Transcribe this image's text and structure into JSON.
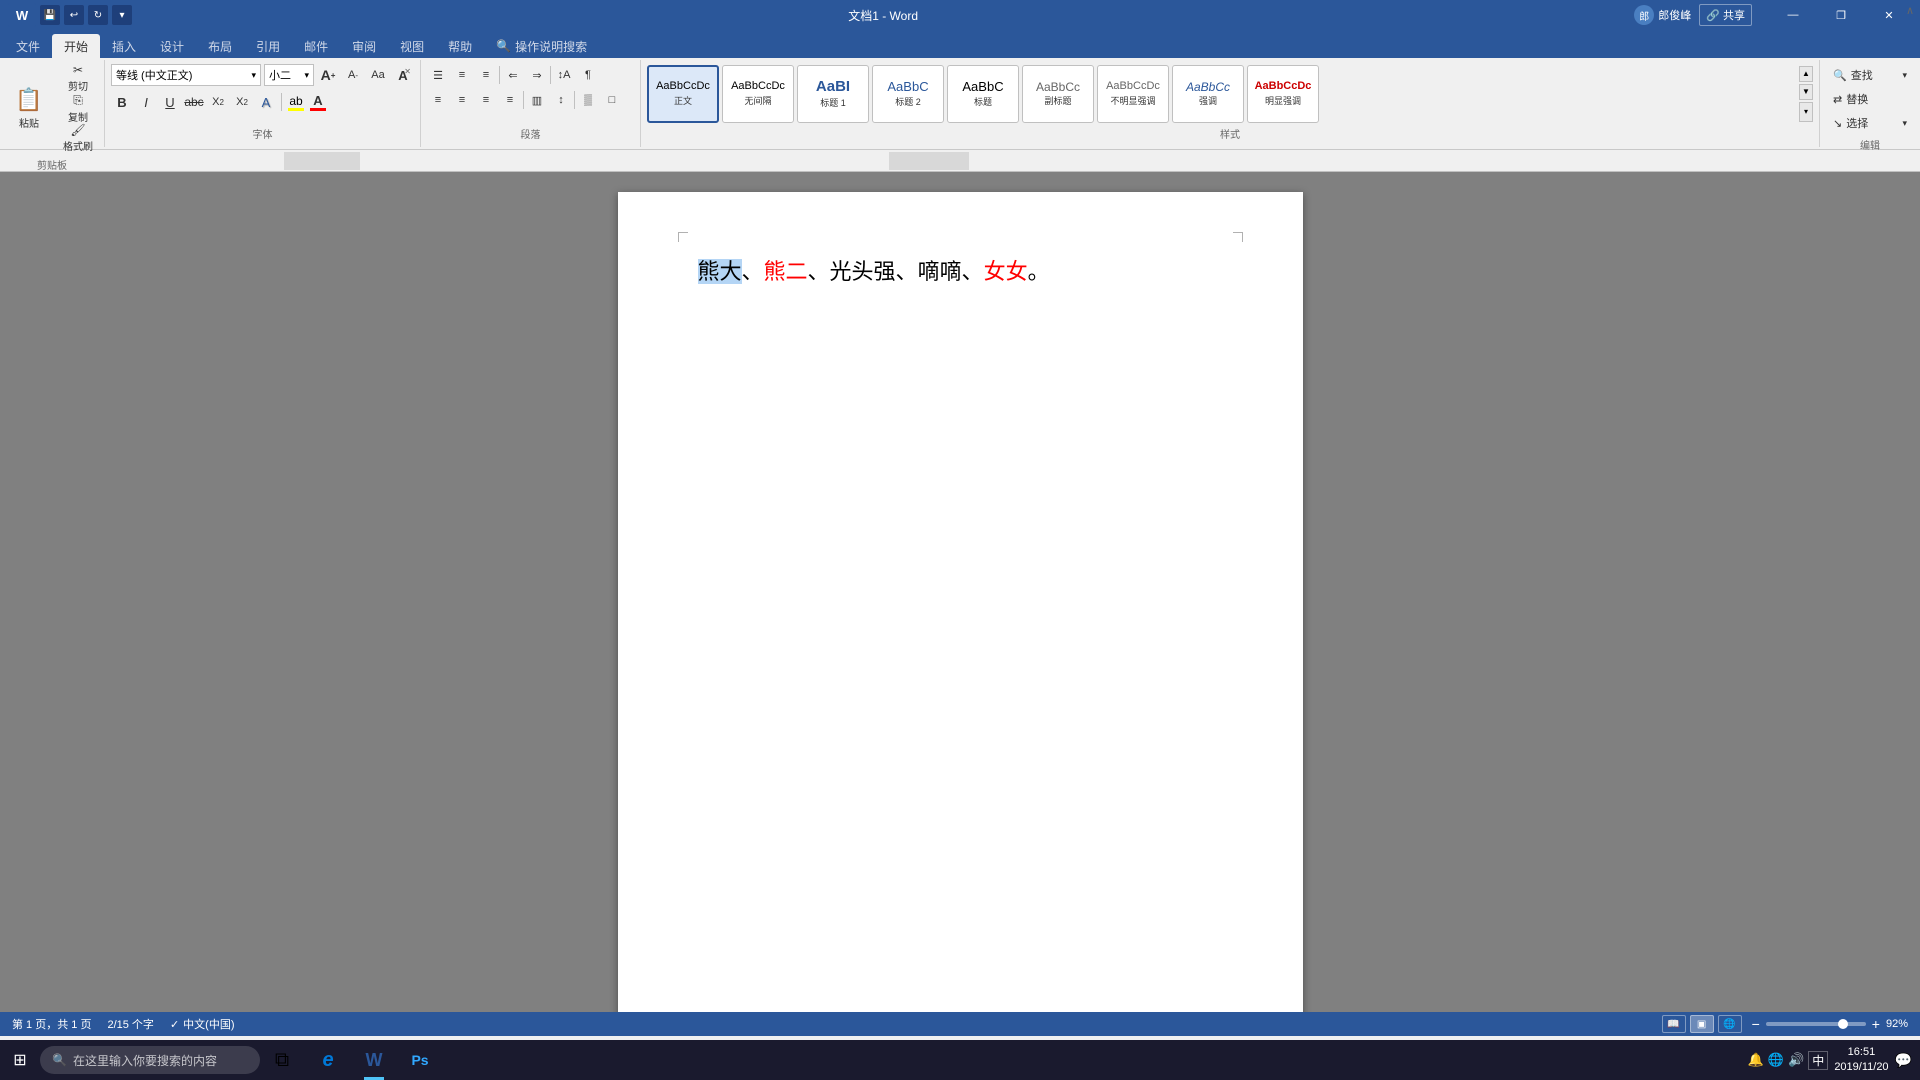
{
  "titlebar": {
    "title": "文档1 - Word",
    "save_icon": "💾",
    "redo_icon": "↻",
    "undo_icon": "↩",
    "minimize": "—",
    "restore": "❐",
    "close": "✕",
    "quick_access": [
      "💾",
      "↩",
      "↻",
      "▾"
    ]
  },
  "tabs": [
    {
      "label": "文件",
      "active": false
    },
    {
      "label": "开始",
      "active": true
    },
    {
      "label": "插入",
      "active": false
    },
    {
      "label": "设计",
      "active": false
    },
    {
      "label": "布局",
      "active": false
    },
    {
      "label": "引用",
      "active": false
    },
    {
      "label": "邮件",
      "active": false
    },
    {
      "label": "审阅",
      "active": false
    },
    {
      "label": "视图",
      "active": false
    },
    {
      "label": "帮助",
      "active": false
    },
    {
      "label": "操作说明搜索",
      "active": false,
      "search": true
    }
  ],
  "ribbon": {
    "clipboard_group": {
      "label": "剪贴板",
      "paste_label": "粘贴",
      "cut_label": "剪切",
      "copy_label": "复制",
      "format_paint_label": "格式刷"
    },
    "font_group": {
      "label": "字体",
      "font_name": "等线 (中文正文)",
      "font_size": "小二",
      "font_size_increase": "A",
      "font_size_decrease": "a",
      "clear_format": "A",
      "change_case": "Aa",
      "bold": "B",
      "italic": "I",
      "underline": "U",
      "strikethrough": "abc",
      "subscript": "X₂",
      "superscript": "X²",
      "text_effect": "A",
      "highlight_color": "ab",
      "font_color": "A",
      "font_color_line": "#ff0000",
      "highlight_line": "#ffff00"
    },
    "para_group": {
      "label": "段落",
      "bullets": "≡",
      "numbering": "≡",
      "multilevel": "≡",
      "decrease_indent": "←",
      "increase_indent": "→",
      "sort": "↕",
      "show_marks": "¶",
      "align_left": "≡",
      "align_center": "≡",
      "align_right": "≡",
      "justify": "≡",
      "col": "▥",
      "line_spacing": "↕",
      "shading": "▒",
      "border": "□"
    },
    "styles_group": {
      "label": "样式",
      "items": [
        {
          "name": "正文",
          "preview": "AaBbCcDc",
          "active": true,
          "color": "#000"
        },
        {
          "name": "无间隔",
          "preview": "AaBbCcDc",
          "active": false,
          "color": "#000"
        },
        {
          "name": "标题 1",
          "preview": "AaBI",
          "active": false,
          "color": "#000"
        },
        {
          "name": "标题 2",
          "preview": "AaBbC",
          "active": false,
          "color": "#2b579a"
        },
        {
          "name": "标题",
          "preview": "AaBbC",
          "active": false,
          "color": "#000"
        },
        {
          "name": "副标题",
          "preview": "AaBbCc",
          "active": false,
          "color": "#666"
        },
        {
          "name": "不明显强调",
          "preview": "AaBbCcDc",
          "active": false,
          "color": "#666"
        },
        {
          "name": "强调",
          "preview": "AaBbCc",
          "active": false,
          "color": "#2b579a"
        },
        {
          "name": "明显强调",
          "preview": "AaBbCcDc",
          "active": false,
          "color": "#cc0000"
        }
      ],
      "expand_btn": "▾"
    },
    "edit_group": {
      "label": "编辑",
      "find": "查找",
      "replace": "替换",
      "select": "选择"
    }
  },
  "document": {
    "content_normal": "熊大、",
    "content_selected": "熊大",
    "content_red_1": "熊二",
    "content_middle": "、光头强、嘀嘀、",
    "content_red_2": "女女",
    "content_end": "。"
  },
  "statusbar": {
    "page_info": "第 1 页，共 1 页",
    "word_count": "2/15 个字",
    "language": "中文(中国)",
    "view_modes": [
      "阅读",
      "页面",
      "Web"
    ],
    "zoom_level": "92%",
    "zoom_minus": "−",
    "zoom_plus": "+"
  },
  "taskbar": {
    "start_icon": "⊞",
    "search_placeholder": "在这里输入你要搜索的内容",
    "search_icon": "🔍",
    "apps": [
      {
        "name": "task-view",
        "icon": "⧉"
      },
      {
        "name": "cortana",
        "icon": "○"
      },
      {
        "name": "edge",
        "icon": "e",
        "active": false
      },
      {
        "name": "word",
        "icon": "W",
        "active": true
      },
      {
        "name": "photoshop",
        "icon": "Ps",
        "active": false
      }
    ],
    "tray_icons": [
      "🔔",
      "🌐",
      "🔊"
    ],
    "time": "16:51",
    "date": "2019/11/20",
    "language_indicator": "中"
  }
}
